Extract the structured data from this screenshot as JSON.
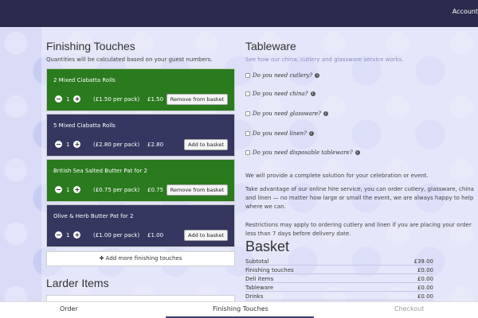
{
  "topbar": {
    "account_label": "Account"
  },
  "finishing": {
    "title": "Finishing Touches",
    "subtitle": "Quantities will be calculated based on your guest numbers.",
    "items": [
      {
        "name": "2 Mixed Ciabatta Rolls",
        "qty": "1",
        "per_pack": "(£1.50 per pack)",
        "price": "£1.50",
        "button": "Remove from basket",
        "state": "in-basket"
      },
      {
        "name": "5 Mixed Ciabatta Rolls",
        "qty": "1",
        "per_pack": "(£2.80 per pack)",
        "price": "£2.80",
        "button": "Add to basket",
        "state": "not-in-basket"
      },
      {
        "name": "British Sea Salted Butter Pat for 2",
        "qty": "1",
        "per_pack": "(£0.75 per pack)",
        "price": "£0.75",
        "button": "Remove from basket",
        "state": "in-basket"
      },
      {
        "name": "Olive & Herb Butter Pat for 2",
        "qty": "1",
        "per_pack": "(£1.00 per pack)",
        "price": "£1.00",
        "button": "Add to basket",
        "state": "not-in-basket"
      }
    ],
    "add_more_label": "Add more finishing touches"
  },
  "larder": {
    "title": "Larder Items"
  },
  "tableware": {
    "title": "Tableware",
    "link_text": "See how our china, cutlery and glassware service works.",
    "questions": [
      "Do you need cutlery?",
      "Do you need china?",
      "Do you need glassware?",
      "Do you need linen?",
      "Do you need disposable tableware?"
    ],
    "para1": "We will provide a complete solution for your celebration or event.",
    "para2": "Take advantage of our online hire service; you can order cutlery, glassware, china and linen — no matter how large or small the event, we are always happy to help where we can.",
    "para3": "Restrictions may apply to ordering cutlery and linen if you are placing your order less than 7 days before delivery date."
  },
  "basket": {
    "title": "Basket",
    "rows": [
      {
        "label": "Subtotal",
        "value": "£39.00"
      },
      {
        "label": "Finishing touches",
        "value": "£0.00"
      },
      {
        "label": "Deli items",
        "value": "£0.00"
      },
      {
        "label": "Tableware",
        "value": "£0.00"
      },
      {
        "label": "Drinks",
        "value": "£0.00"
      }
    ]
  },
  "bottom_nav": {
    "tabs": [
      "Order",
      "Finishing Touches",
      "Checkout"
    ],
    "active": "Finishing Touches"
  },
  "colors": {
    "header_bg": "#2b2c4d",
    "card_in_basket": "#2a7a1e",
    "card_default": "#353760",
    "link": "#8a8cc2"
  }
}
